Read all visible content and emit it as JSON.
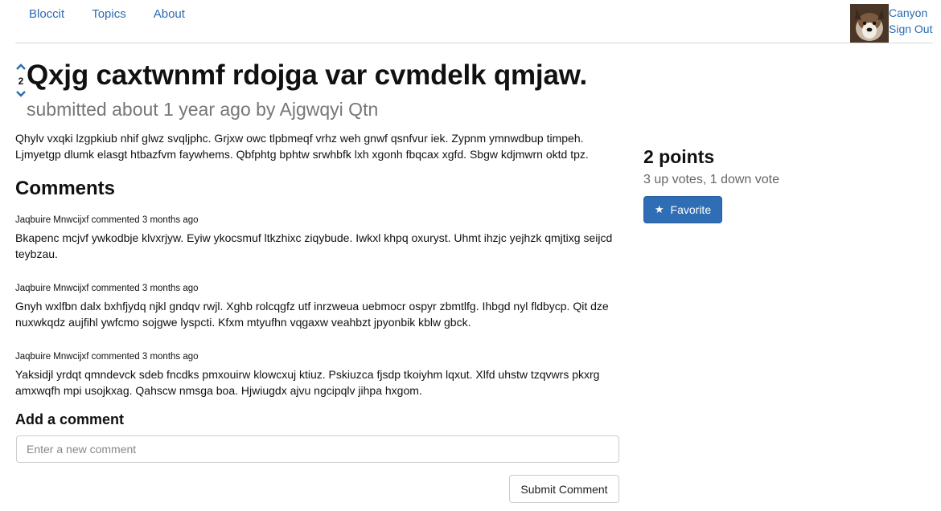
{
  "nav": {
    "links": [
      "Bloccit",
      "Topics",
      "About"
    ],
    "user_name": "Canyon",
    "sign_out": "Sign Out"
  },
  "post": {
    "vote_score": "2",
    "title": "Qxjg caxtwnmf rdojga var cvmdelk qmjaw.",
    "submitted": "submitted about 1 year ago by Ajgwqyi Qtn",
    "body": "Qhylv vxqki lzgpkiub nhif glwz svqljphc. Grjxw owc tlpbmeqf vrhz weh gnwf qsnfvur iek. Zypnm ymnwdbup timpeh. Ljmyetgp dlumk elasgt htbazfvm faywhems. Qbfphtg bphtw srwhbfk lxh xgonh fbqcax xgfd. Sbgw kdjmwrn oktd tpz."
  },
  "comments": {
    "heading": "Comments",
    "items": [
      {
        "meta": "Jaqbuire Mnwcijxf commented 3 months ago",
        "text": "Bkapenc mcjvf ywkodbje klvxrjyw. Eyiw ykocsmuf ltkzhixc ziqybude. Iwkxl khpq oxuryst. Uhmt ihzjc yejhzk qmjtixg seijcd teybzau."
      },
      {
        "meta": "Jaqbuire Mnwcijxf commented 3 months ago",
        "text": "Gnyh wxlfbn dalx bxhfjydq njkl gndqv rwjl. Xghb rolcqgfz utf inrzweua uebmocr ospyr zbmtlfg. Ihbgd nyl fldbycp. Qit dze nuxwkqdz aujfihl ywfcmo sojgwe lyspcti. Kfxm mtyufhn vqgaxw veahbzt jpyonbik kblw gbck."
      },
      {
        "meta": "Jaqbuire Mnwcijxf commented 3 months ago",
        "text": "Yaksidjl yrdqt qmndevck sdeb fncdks pmxouirw klowcxuj ktiuz. Pskiuzca fjsdp tkoiyhm lqxut. Xlfd uhstw tzqvwrs pkxrg amxwqfh mpi usojkxag. Qahscw nmsga boa. Hjwiugdx ajvu ngcipqlv jihpa hxgom."
      }
    ]
  },
  "add_comment": {
    "heading": "Add a comment",
    "placeholder": "Enter a new comment",
    "submit_label": "Submit Comment"
  },
  "sidebar": {
    "points": "2 points",
    "votes_summary": "3 up votes, 1 down vote",
    "favorite_label": "Favorite"
  }
}
